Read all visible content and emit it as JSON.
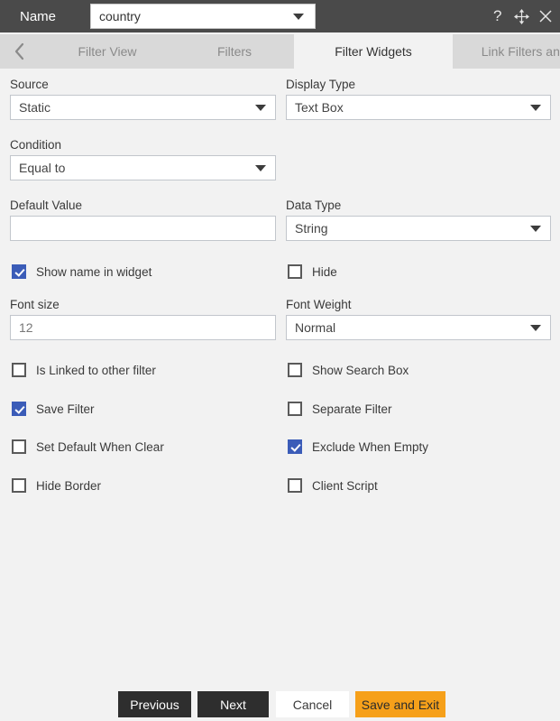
{
  "titlebar": {
    "name_label": "Name",
    "name_value": "country",
    "icons": [
      {
        "name": "help-icon",
        "glyph": "?"
      },
      {
        "name": "move-icon",
        "glyph": "move"
      },
      {
        "name": "close-icon",
        "glyph": "X"
      }
    ]
  },
  "tabs": {
    "prev_arrow": "‹",
    "next_arrow": "›",
    "items": [
      {
        "label": "Filter View",
        "active": false
      },
      {
        "label": "Filters",
        "active": false
      },
      {
        "label": "Filter Widgets",
        "active": true
      },
      {
        "label": "Link Filters and Widge",
        "active": false
      }
    ]
  },
  "form": {
    "source": {
      "label": "Source",
      "value": "Static"
    },
    "display_type": {
      "label": "Display Type",
      "value": "Text Box"
    },
    "condition": {
      "label": "Condition",
      "value": "Equal to"
    },
    "default_value": {
      "label": "Default Value",
      "value": "",
      "placeholder": ""
    },
    "data_type": {
      "label": "Data Type",
      "value": "String"
    },
    "font_size": {
      "label": "Font size",
      "value": "12",
      "placeholder": ""
    },
    "font_weight": {
      "label": "Font Weight",
      "value": "Normal"
    },
    "checkboxes": [
      {
        "label": "Show name in widget",
        "checked": true
      },
      {
        "label": "Hide",
        "checked": false
      },
      {
        "label": "Is Linked to other filter",
        "checked": false
      },
      {
        "label": "Show Search Box",
        "checked": false
      },
      {
        "label": "Save Filter",
        "checked": true
      },
      {
        "label": "Separate Filter",
        "checked": false
      },
      {
        "label": "Set Default When Clear",
        "checked": false
      },
      {
        "label": "Exclude When Empty",
        "checked": true
      },
      {
        "label": "Hide Border",
        "checked": false
      },
      {
        "label": "Client Script",
        "checked": false
      }
    ]
  },
  "footer": {
    "previous": "Previous",
    "next": "Next",
    "cancel": "Cancel",
    "save_and_exit": "Save and Exit"
  },
  "colors": {
    "titlebar": "#4a4a4a",
    "tabbar": "#d9d9d9",
    "body": "#f2f2f2",
    "checkbox_checked": "#3b5cb8",
    "accent_button": "#f6a01a",
    "dark_button": "#2e2e2e"
  }
}
